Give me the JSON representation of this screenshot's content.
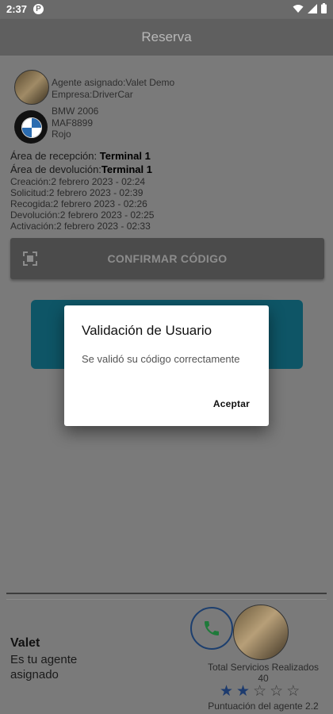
{
  "status_bar": {
    "time": "2:37",
    "app_badge": "P",
    "icons": [
      "wifi-icon",
      "signal-icon",
      "battery-icon"
    ]
  },
  "app_bar": {
    "title": "Reserva"
  },
  "agent": {
    "label": "Agente asignado:Valet  Demo",
    "company": "Empresa:DriverCar"
  },
  "car": {
    "model": "BMW 2006",
    "plate": "MAF8899",
    "color": "Rojo"
  },
  "areas": {
    "reception_label": "Área de recepción: ",
    "reception_value": "Terminal 1",
    "return_label": "Área de devolución:",
    "return_value": "Terminal 1"
  },
  "dates": [
    "Creación:2 febrero 2023 - 02:24",
    "Solicitud:2 febrero 2023 - 02:39",
    "Recogida:2 febrero 2023 - 02:26",
    "Devolución:2 febrero 2023 - 02:25",
    "Activación:2 febrero 2023 - 02:33"
  ],
  "confirm_button": {
    "label": "CONFIRMAR CÓDIGO"
  },
  "footer": {
    "title": "Valet",
    "subtitle_1": "Es tu agente",
    "subtitle_2": "asignado",
    "services_label": "Total Servicios Realizados",
    "services_count": "40",
    "rating": {
      "value": 2,
      "max": 5
    },
    "score_label": "Puntuación del agente 2.2"
  },
  "dialog": {
    "title": "Validación de Usuario",
    "message": "Se validó su código correctamente",
    "button": "Aceptar"
  },
  "colors": {
    "star_filled": "#1d3b6e",
    "teal_button": "#0e5566",
    "phone_ring": "#1d3f6e"
  }
}
